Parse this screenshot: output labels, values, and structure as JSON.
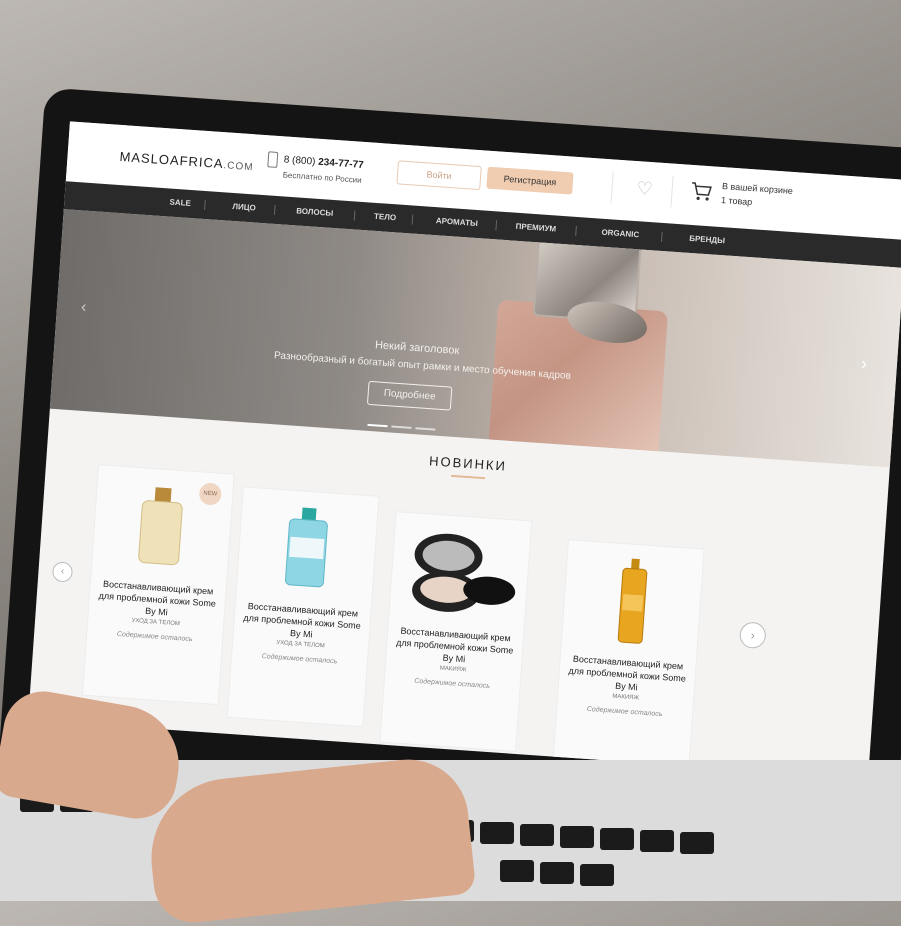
{
  "header": {
    "logo_main": "MASLOAFRICA",
    "logo_suffix": ".COM",
    "phone_prefix": "8 (800) ",
    "phone_number": "234-77-77",
    "phone_sub": "Бесплатно по России",
    "login_label": "Войти",
    "register_label": "Регистрация",
    "cart_line1": "В вашей корзине",
    "cart_line2": "1 товар"
  },
  "nav": {
    "items": [
      "SALE",
      "ЛИЦО",
      "ВОЛОСЫ",
      "ТЕЛО",
      "АРОМАТЫ",
      "ПРЕМИУМ",
      "ORGANIC",
      "БРЕНДЫ"
    ]
  },
  "hero": {
    "title": "Некий заголовок",
    "subtitle": "Разнообразный и богатый опыт рамки и место обучения кадров",
    "button_label": "Подробнее",
    "arrow_left": "‹",
    "arrow_right": "›"
  },
  "new_section": {
    "title": "НОВИНКИ",
    "prev_label": "‹",
    "next_label": "›",
    "products": [
      {
        "name": "Восстанавливающий крем для проблемной кожи Some By Mi",
        "category": "УХОД ЗА ТЕЛОМ",
        "stock": "Содержимое осталось",
        "badge": "NEW"
      },
      {
        "name": "Восстанавливающий крем для проблемной кожи Some By Mi",
        "category": "УХОД ЗА ТЕЛОМ",
        "stock": "Содержимое осталось",
        "badge": ""
      },
      {
        "name": "Восстанавливающий крем для проблемной кожи Some By Mi",
        "category": "МАКИЯЖ",
        "stock": "Содержимое осталось",
        "badge": ""
      },
      {
        "name": "Восстанавливающий крем для проблемной кожи Some By Mi",
        "category": "МАКИЯЖ",
        "stock": "Содержимое осталось",
        "badge": ""
      }
    ]
  },
  "colors": {
    "accent": "#f0ccb0",
    "nav_bg": "#2a2a2a",
    "underline": "#e2b996"
  }
}
